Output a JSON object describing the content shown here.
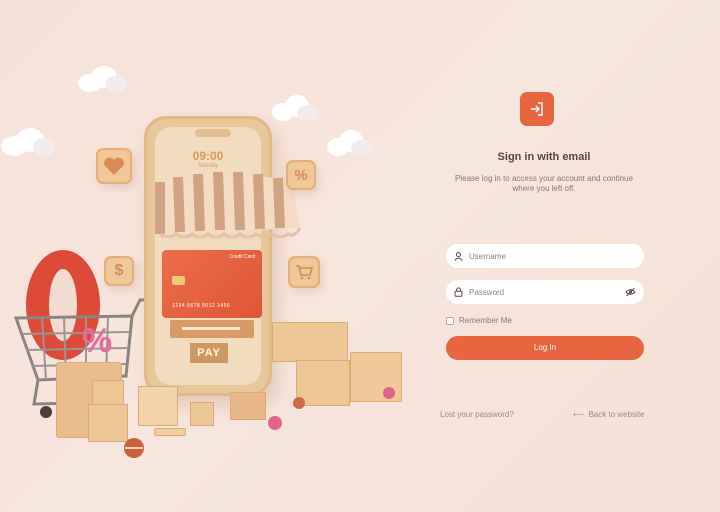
{
  "illustration": {
    "phone_time": "09:00",
    "phone_day": "Sunday",
    "card_label": "Credit Card",
    "card_number": "1234 5678 9012 3456",
    "pay_label": "PAY",
    "icons": [
      "heart-icon",
      "percent-icon",
      "dollar-icon",
      "cart-icon"
    ]
  },
  "login": {
    "logo_icon": "sign-in-icon",
    "title": "Sign in with email",
    "subtitle": "Please log in to access your account and continue where you left off.",
    "username_placeholder": "Username",
    "password_placeholder": "Password",
    "remember_label": "Remember Me",
    "login_button": "Log In",
    "lost_password": "Lost your password?",
    "back_to_website": "Back to website"
  },
  "colors": {
    "accent": "#e8663f",
    "background": "#f6e2d8",
    "field": "#ffffff"
  }
}
